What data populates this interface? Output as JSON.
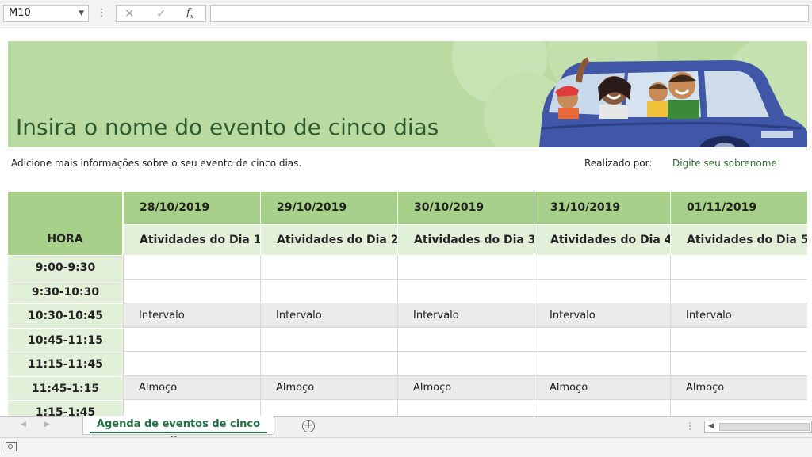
{
  "formula_bar": {
    "name_box": "M10",
    "separator": "⋮",
    "cancel_icon": "✕",
    "enter_icon": "✓",
    "fx_label": "f",
    "fx_sub": "x",
    "formula_value": ""
  },
  "banner": {
    "title": "Insira o nome do evento de cinco dias",
    "colors": {
      "background": "#b9dba2",
      "title": "#2c5a2c"
    }
  },
  "subtitle": "Adicione mais informações sobre o seu evento de cinco dias.",
  "realizado": {
    "label": "Realizado por:",
    "value": "Digite seu sobrenome"
  },
  "table": {
    "hora_header": "HORA",
    "dates": [
      "28/10/2019",
      "29/10/2019",
      "30/10/2019",
      "31/10/2019",
      "01/11/2019"
    ],
    "day_headers": [
      "Atividades do Dia 1",
      "Atividades do Dia 2",
      "Atividades do Dia 3",
      "Atividades do Dia 4",
      "Atividades do Dia 5"
    ],
    "rows": [
      {
        "time": "9:00-9:30",
        "cells": [
          "",
          "",
          "",
          "",
          ""
        ]
      },
      {
        "time": "9:30-10:30",
        "cells": [
          "",
          "",
          "",
          "",
          ""
        ]
      },
      {
        "time": "10:30-10:45",
        "cells": [
          "Intervalo",
          "Intervalo",
          "Intervalo",
          "Intervalo",
          "Intervalo"
        ]
      },
      {
        "time": "10:45-11:15",
        "cells": [
          "",
          "",
          "",
          "",
          ""
        ]
      },
      {
        "time": "11:15-11:45",
        "cells": [
          "",
          "",
          "",
          "",
          ""
        ]
      },
      {
        "time": "11:45-1:15",
        "cells": [
          "Almoço",
          "Almoço",
          "Almoço",
          "Almoço",
          "Almoço"
        ]
      },
      {
        "time": "1:15-1:45",
        "cells": [
          "",
          "",
          "",
          "",
          ""
        ]
      }
    ],
    "colors": {
      "header": "#a7d08a",
      "subheader": "#e2efd9",
      "shaded_row": "#ebebeb"
    }
  },
  "sheet_tabs": {
    "prev_icon": "◀",
    "next_icon": "▶",
    "active": "Agenda de eventos de cinco dias",
    "add_icon": "+",
    "menu_dots": "⋮",
    "scroll_left_icon": "◀",
    "accent": "#217346"
  }
}
